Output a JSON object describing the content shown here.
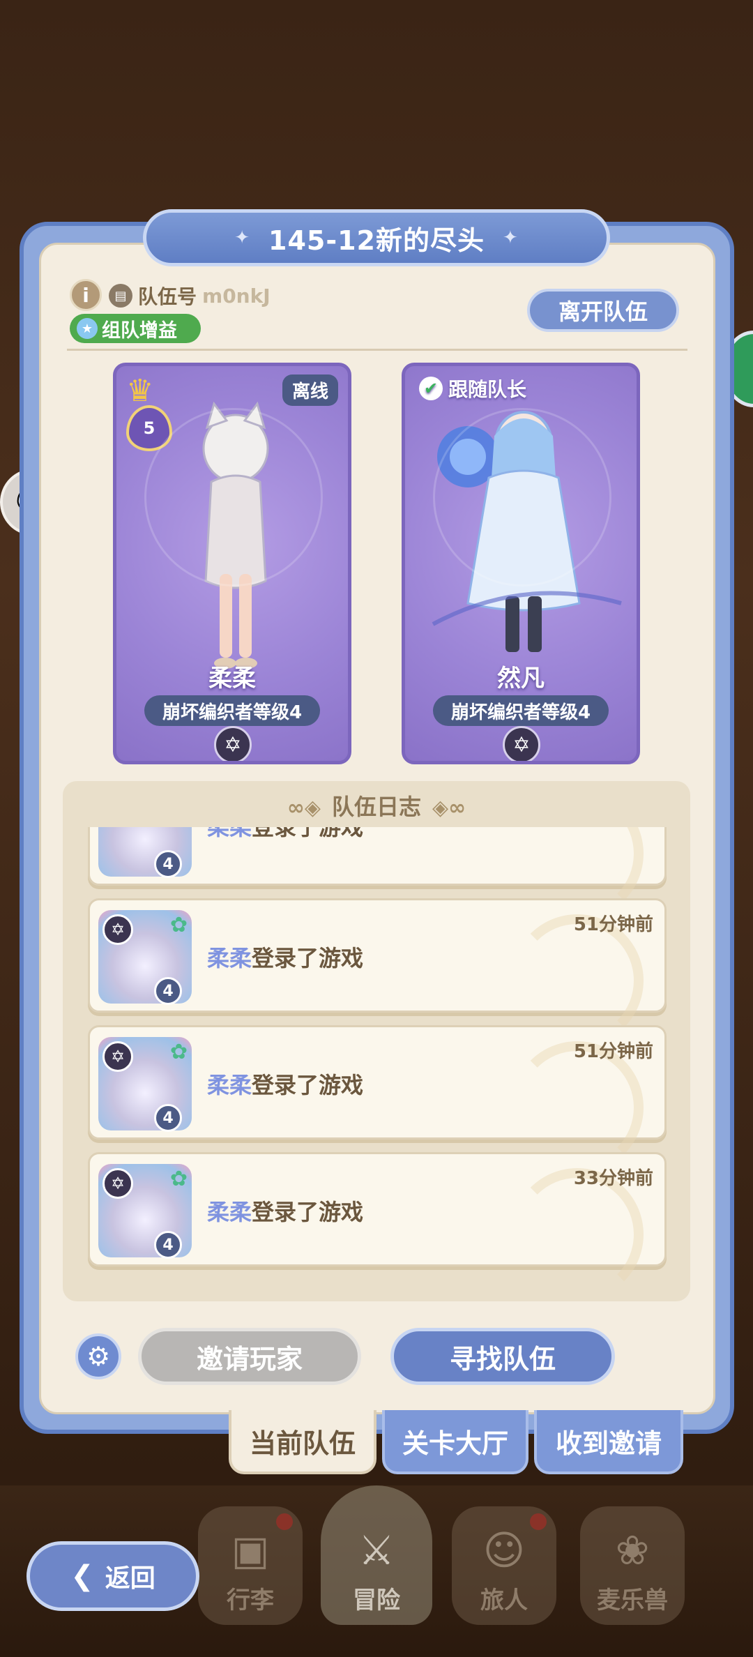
{
  "team": {
    "title": "145-12新的尽头",
    "info_icon": "i",
    "team_no_label": "队伍号",
    "team_no_value": "m0nkJ",
    "buff_label": "组队增益",
    "leave_label": "离开队伍"
  },
  "members": [
    {
      "name": "柔柔",
      "rank": "崩坏编织者等级4",
      "status": "离线",
      "is_captain": true,
      "heart_level": "5"
    },
    {
      "name": "然凡",
      "rank": "崩坏编织者等级4",
      "follow_label": "跟随队长",
      "is_captain": false
    }
  ],
  "log": {
    "title": "队伍日志",
    "items": [
      {
        "who": "柔柔",
        "action": "登录了游戏",
        "time": "",
        "level": "4"
      },
      {
        "who": "柔柔",
        "action": "登录了游戏",
        "time": "51分钟前",
        "level": "4"
      },
      {
        "who": "柔柔",
        "action": "登录了游戏",
        "time": "51分钟前",
        "level": "4"
      },
      {
        "who": "柔柔",
        "action": "登录了游戏",
        "time": "33分钟前",
        "level": "4"
      }
    ]
  },
  "actions": {
    "invite_label": "邀请玩家",
    "find_label": "寻找队伍"
  },
  "tabs": [
    {
      "label": "当前队伍",
      "active": true
    },
    {
      "label": "关卡大厅",
      "active": false
    },
    {
      "label": "收到邀请",
      "active": false
    }
  ],
  "nav": {
    "back_label": "返回",
    "items": [
      {
        "label": "行李",
        "icon": "bag-icon",
        "badge": true
      },
      {
        "label": "冒险",
        "icon": "crossed-swords-icon",
        "badge": false
      },
      {
        "label": "旅人",
        "icon": "person-icon",
        "badge": true
      },
      {
        "label": "麦乐兽",
        "icon": "pet-icon",
        "badge": false
      }
    ]
  },
  "colors": {
    "panel_blue": "#8ea8dc",
    "panel_cream": "#f4ede0",
    "card_purple": "#9b84d6",
    "buff_green": "#4faa4e",
    "name_highlight": "#7f93e0"
  }
}
